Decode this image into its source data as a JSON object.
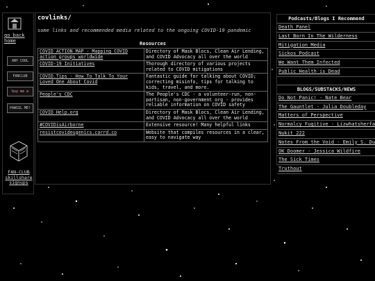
{
  "page": {
    "title": "covlinks/",
    "subtitle": "some links and recommended media related to the ongoing COVID-19 pandemic"
  },
  "sidebar": {
    "back_label": "go back home",
    "badges": [
      "ANY COOL STUFF",
      "FANCLUB",
      "buy me a ko-fi",
      "PAWSIL ME!"
    ],
    "fanclub_label": "FAN-CLUB skillshare signups"
  },
  "resources": {
    "header": "Resources",
    "rows": [
      {
        "link": "COVID ACTION MAP - Mapping COVID action groups worldwide",
        "desc": "Directory of Mask Blocs, Clean Air Lending, and COVID Advocacy all over the world"
      },
      {
        "link": "COVID-19 Initiatives",
        "desc": "Thorough directory of various projects related to COVID mitigations"
      },
      {
        "link": "COVID.Tips - How To Talk To Your Loved One About Covid",
        "desc": "Fantastic guide for talking about COVID; correcting misinfo, tips for talking to kids, travel, and more."
      },
      {
        "link": "People's CDC",
        "desc": "The People's CDC - a volunteer-run, non-partisan, non-government org - provides reliable information on COVID safety"
      },
      {
        "link": "COVID Help.org",
        "desc": "Directory of Mask Blocs, Clean Air Lending, and COVID Advocacy all over the world"
      },
      {
        "link": "#COVIDisAirborne",
        "desc": "Extensive resource! Many helpful links"
      },
      {
        "link": "resistcovideugenics.carrd.co",
        "desc": "Website that compiles resources in a clear, easy to navigate way"
      }
    ]
  },
  "podcasts": {
    "header": "Podcasts/Blogs I Recommend",
    "items": [
      "Death Panel",
      "Last Born In The Wilderness",
      "Mitigation Media",
      "Sickos Podcast",
      "We Want Them Infected",
      "Public Health is Dead"
    ]
  },
  "blogs": {
    "header": "BLOGS/SUBSTACKS/NEWS",
    "items": [
      "Do Not Panic! - Nate Bear",
      "The Gauntlet - Julia Doubleday",
      "Matters of Perspective",
      "Normalcy Fugitive - Lizwhatsherface",
      "Nukit 222",
      "Notes From the Void - Emily S. Dunn",
      "OK Doomer - Jessica Wildfire",
      "The Sick Times",
      "Truthout"
    ]
  }
}
